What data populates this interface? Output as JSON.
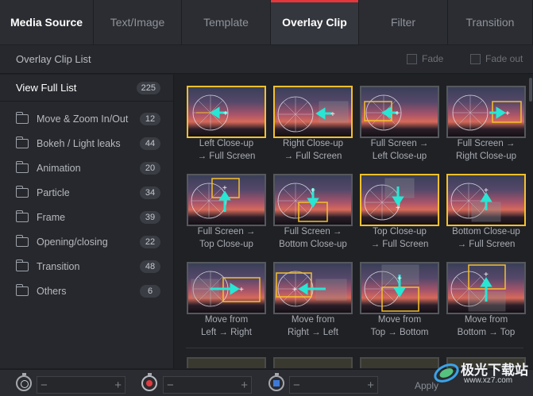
{
  "tabs": [
    "Media Source",
    "Text/Image",
    "Template",
    "Overlay Clip",
    "Filter",
    "Transition"
  ],
  "active_tab": "Overlay Clip",
  "accent": "#e6363c",
  "highlight": "#f5c02c",
  "arrow_color": "#28e6d4",
  "header": {
    "title": "Overlay Clip List",
    "fade_in": "Fade",
    "fade_out": "Fade out"
  },
  "sidebar": {
    "view_all": {
      "label": "View Full List",
      "count": "225"
    },
    "items": [
      {
        "label": "Move & Zoom In/Out",
        "count": "12"
      },
      {
        "label": "Bokeh / Light leaks",
        "count": "44"
      },
      {
        "label": "Animation",
        "count": "20"
      },
      {
        "label": "Particle",
        "count": "34"
      },
      {
        "label": "Frame",
        "count": "39"
      },
      {
        "label": "Opening/closing",
        "count": "22"
      },
      {
        "label": "Transition",
        "count": "48"
      },
      {
        "label": "Others",
        "count": "6"
      }
    ]
  },
  "clips": [
    {
      "line1": "Left Close-up",
      "line2": "→ Full Screen"
    },
    {
      "line1": "Right Close-up",
      "line2": "→ Full Screen"
    },
    {
      "line1": "Full Screen →",
      "line2": "Left Close-up"
    },
    {
      "line1": "Full Screen →",
      "line2": "Right Close-up"
    },
    {
      "line1": "Full Screen →",
      "line2": "Top Close-up"
    },
    {
      "line1": "Full Screen →",
      "line2": "Bottom Close-up"
    },
    {
      "line1": "Top Close-up",
      "line2": "→ Full Screen"
    },
    {
      "line1": "Bottom Close-up",
      "line2": "→ Full Screen"
    },
    {
      "line1": "Move from",
      "line2": "Left → Right"
    },
    {
      "line1": "Move from",
      "line2": "Right → Left"
    },
    {
      "line1": "Move from",
      "line2": "Top → Bottom"
    },
    {
      "line1": "Move from",
      "line2": "Bottom → Top"
    }
  ],
  "bottom": {
    "minus": "−",
    "plus": "+",
    "apply": "Apply"
  },
  "watermark": {
    "text": "极光下载站",
    "url": "www.xz7.com"
  }
}
